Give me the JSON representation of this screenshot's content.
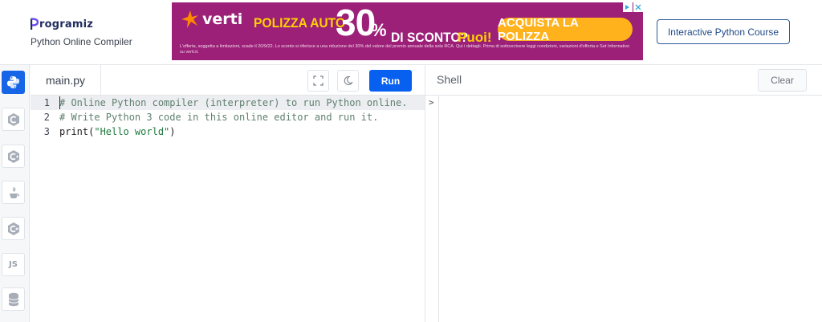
{
  "brand": {
    "logo_text": "rogramiz",
    "subtitle": "Python Online Compiler"
  },
  "ad": {
    "brand": "verti",
    "headline_1": "POLIZZA AUTO",
    "big_number": "30",
    "percent": "%",
    "headline_2": "DI SCONTO?",
    "headline_3": "Puoi!",
    "cta": "ACQUISTA LA POLIZZA",
    "fine_print": "L'offerta, soggetta a limitazioni, scade il 20/9/22. Lo sconto si riferisce a una riduzione del 30% del valore del premio annuale della sola RCA. Qui i dettagli. Prima di sottoscrivere leggi condizioni, variazioni d'offerta e Set Informativo su verti.it.",
    "colors": {
      "background": "#9c1f78",
      "accent": "#ffd100",
      "cta": "#ffb21b"
    }
  },
  "header": {
    "course_button": "Interactive Python Course"
  },
  "sidebar": {
    "languages": [
      {
        "name": "python-icon",
        "active": true
      },
      {
        "name": "c-icon"
      },
      {
        "name": "cpp-icon"
      },
      {
        "name": "java-icon"
      },
      {
        "name": "csharp-icon"
      },
      {
        "name": "javascript-icon",
        "label": "JS"
      },
      {
        "name": "database-icon"
      }
    ]
  },
  "editor": {
    "tab_label": "main.py",
    "run_label": "Run",
    "lines": [
      {
        "num": "1",
        "text": "# Online Python compiler (interpreter) to run Python online."
      },
      {
        "num": "2",
        "text": "# Write Python 3 code in this online editor and run it."
      },
      {
        "num": "3",
        "code_prefix": "print(",
        "code_string": "\"Hello world\"",
        "code_suffix": ")"
      }
    ]
  },
  "shell": {
    "title": "Shell",
    "clear_label": "Clear",
    "prompt": ">"
  },
  "colors": {
    "primary": "#0860f0",
    "brand_navy": "#1f2d5c"
  }
}
